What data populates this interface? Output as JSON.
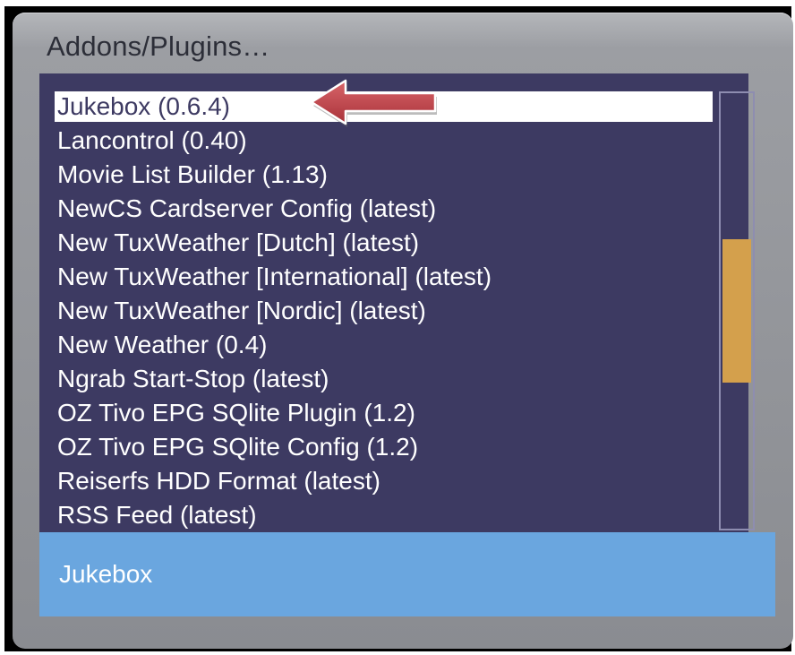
{
  "window": {
    "title": "Addons/Plugins…"
  },
  "list": {
    "items": [
      {
        "label": "Jukebox (0.6.4)",
        "selected": true
      },
      {
        "label": "Lancontrol (0.40)"
      },
      {
        "label": "Movie List Builder (1.13)"
      },
      {
        "label": "NewCS Cardserver Config (latest)"
      },
      {
        "label": "New TuxWeather [Dutch] (latest)"
      },
      {
        "label": "New TuxWeather [International] (latest)"
      },
      {
        "label": "New TuxWeather [Nordic] (latest)"
      },
      {
        "label": "New Weather (0.4)"
      },
      {
        "label": "Ngrab Start-Stop (latest)"
      },
      {
        "label": "OZ Tivo EPG SQlite Plugin (1.2)"
      },
      {
        "label": "OZ Tivo EPG SQlite Config (1.2)"
      },
      {
        "label": "Reiserfs HDD Format (latest)"
      },
      {
        "label": "RSS Feed (latest)"
      }
    ]
  },
  "status": {
    "text": "Jukebox"
  },
  "colors": {
    "list_background": "#3d3a62",
    "status_background": "#6aa6df",
    "scroll_thumb": "#d4a04c",
    "annotation_arrow": "#c0444a"
  },
  "icons": {
    "annotation": "left-arrow-icon"
  }
}
